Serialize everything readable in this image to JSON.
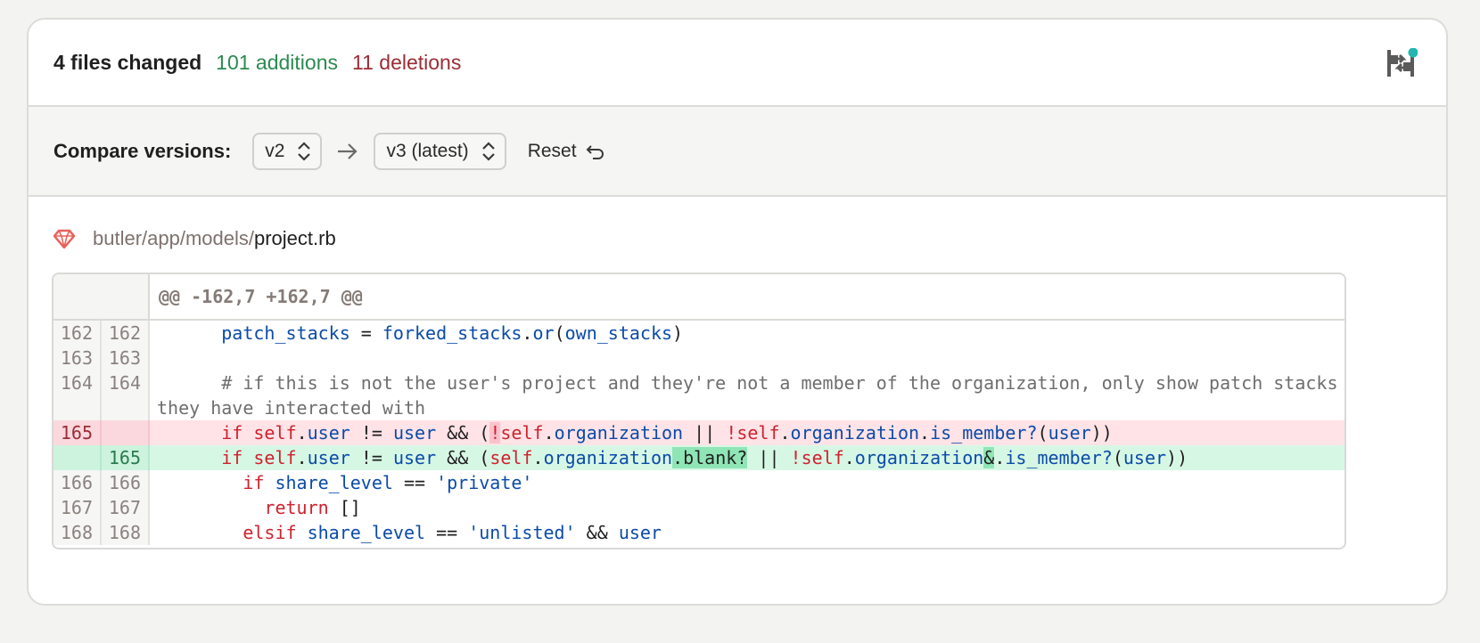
{
  "summary": {
    "files_changed": "4 files changed",
    "additions": "101 additions",
    "deletions": "11 deletions"
  },
  "compare": {
    "label": "Compare versions:",
    "from": "v2",
    "to": "v3 (latest)",
    "reset_label": "Reset"
  },
  "file": {
    "dir": "butler/app/models/",
    "name": "project.rb"
  },
  "diff": {
    "hunk_header": "@@ -162,7 +162,7 @@",
    "rows": [
      {
        "old": "162",
        "new": "162"
      },
      {
        "old": "163",
        "new": "163"
      },
      {
        "old": "164",
        "new": "164"
      },
      {
        "old": "165",
        "new": ""
      },
      {
        "old": "",
        "new": "165"
      },
      {
        "old": "166",
        "new": "166"
      },
      {
        "old": "167",
        "new": "167"
      },
      {
        "old": "168",
        "new": "168"
      }
    ],
    "tokens": {
      "patch_stacks": "patch_stacks",
      "eq": " = ",
      "forked_stacks": "forked_stacks",
      "dot": ".",
      "or": "or",
      "lp": "(",
      "own_stacks": "own_stacks",
      "rp": ")",
      "comment": "# if this is not the user's project and they're not a member of the organization, only show patch stacks they have interacted with",
      "if": "if",
      "self": "self",
      "user": "user",
      "neq": " != ",
      "and": " && ",
      "bang": "!",
      "organization": "organization",
      "orop": " || ",
      "is_member": "is_member?",
      "rpp": "))",
      "blank_q": ".blank?",
      "amp": "&",
      "share_level": "share_level",
      "eqeq": " == ",
      "private": "'private'",
      "return": "return",
      "empty_arr": "[]",
      "elsif": "elsif",
      "unlisted": "'unlisted'"
    }
  },
  "colors": {
    "additions": "#2b8a4f",
    "deletions": "#9b2c35",
    "notification_dot": "#22b8b0"
  }
}
